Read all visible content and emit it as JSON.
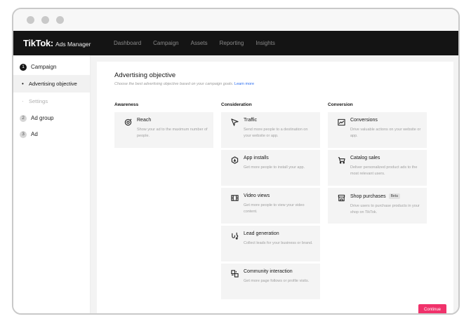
{
  "app": {
    "logo_main": "TikTok",
    "logo_colon": ":",
    "logo_sub": "Ads Manager"
  },
  "nav": {
    "items": [
      "Dashboard",
      "Campaign",
      "Assets",
      "Reporting",
      "Insights"
    ]
  },
  "sidebar": {
    "step1_num": "1",
    "step1_label": "Campaign",
    "sub_active_label": "Advertising objective",
    "sub_inactive_label": "Settings",
    "step2_num": "2",
    "step2_label": "Ad group",
    "step3_num": "3",
    "step3_label": "Ad"
  },
  "panel": {
    "title": "Advertising objective",
    "subtitle": "Choose the best advertising objective based on your campaign goals.",
    "learn_more": "Learn more"
  },
  "columns": {
    "awareness": {
      "heading": "Awareness",
      "cards": [
        {
          "title": "Reach",
          "desc": "Show your ad to the maximum number of people.",
          "icon": "target-icon"
        }
      ]
    },
    "consideration": {
      "heading": "Consideration",
      "cards": [
        {
          "title": "Traffic",
          "desc": "Send more people to a destination on your website or app.",
          "icon": "cursor-icon"
        },
        {
          "title": "App installs",
          "desc": "Get more people to install your app.",
          "icon": "download-icon"
        },
        {
          "title": "Video views",
          "desc": "Get more people to view your video content.",
          "icon": "film-icon"
        },
        {
          "title": "Lead generation",
          "desc": "Collect leads for your business or brand.",
          "icon": "magnet-icon"
        },
        {
          "title": "Community interaction",
          "desc": "Get more page follows or profile visits.",
          "icon": "community-icon"
        }
      ]
    },
    "conversion": {
      "heading": "Conversion",
      "cards": [
        {
          "title": "Conversions",
          "desc": "Drive valuable actions on your website or app.",
          "icon": "trend-icon"
        },
        {
          "title": "Catalog sales",
          "desc": "Deliver personalized product ads to the most relevant users.",
          "icon": "cart-icon"
        },
        {
          "title": "Shop purchases",
          "badge": "Beta",
          "desc": "Drive users to purchase products in your shop on TikTok.",
          "icon": "shop-icon"
        }
      ]
    }
  },
  "footer": {
    "continue_label": "Continue"
  },
  "colors": {
    "accent": "#f0326b",
    "nav_bg": "#141414",
    "link": "#2a6df0"
  }
}
